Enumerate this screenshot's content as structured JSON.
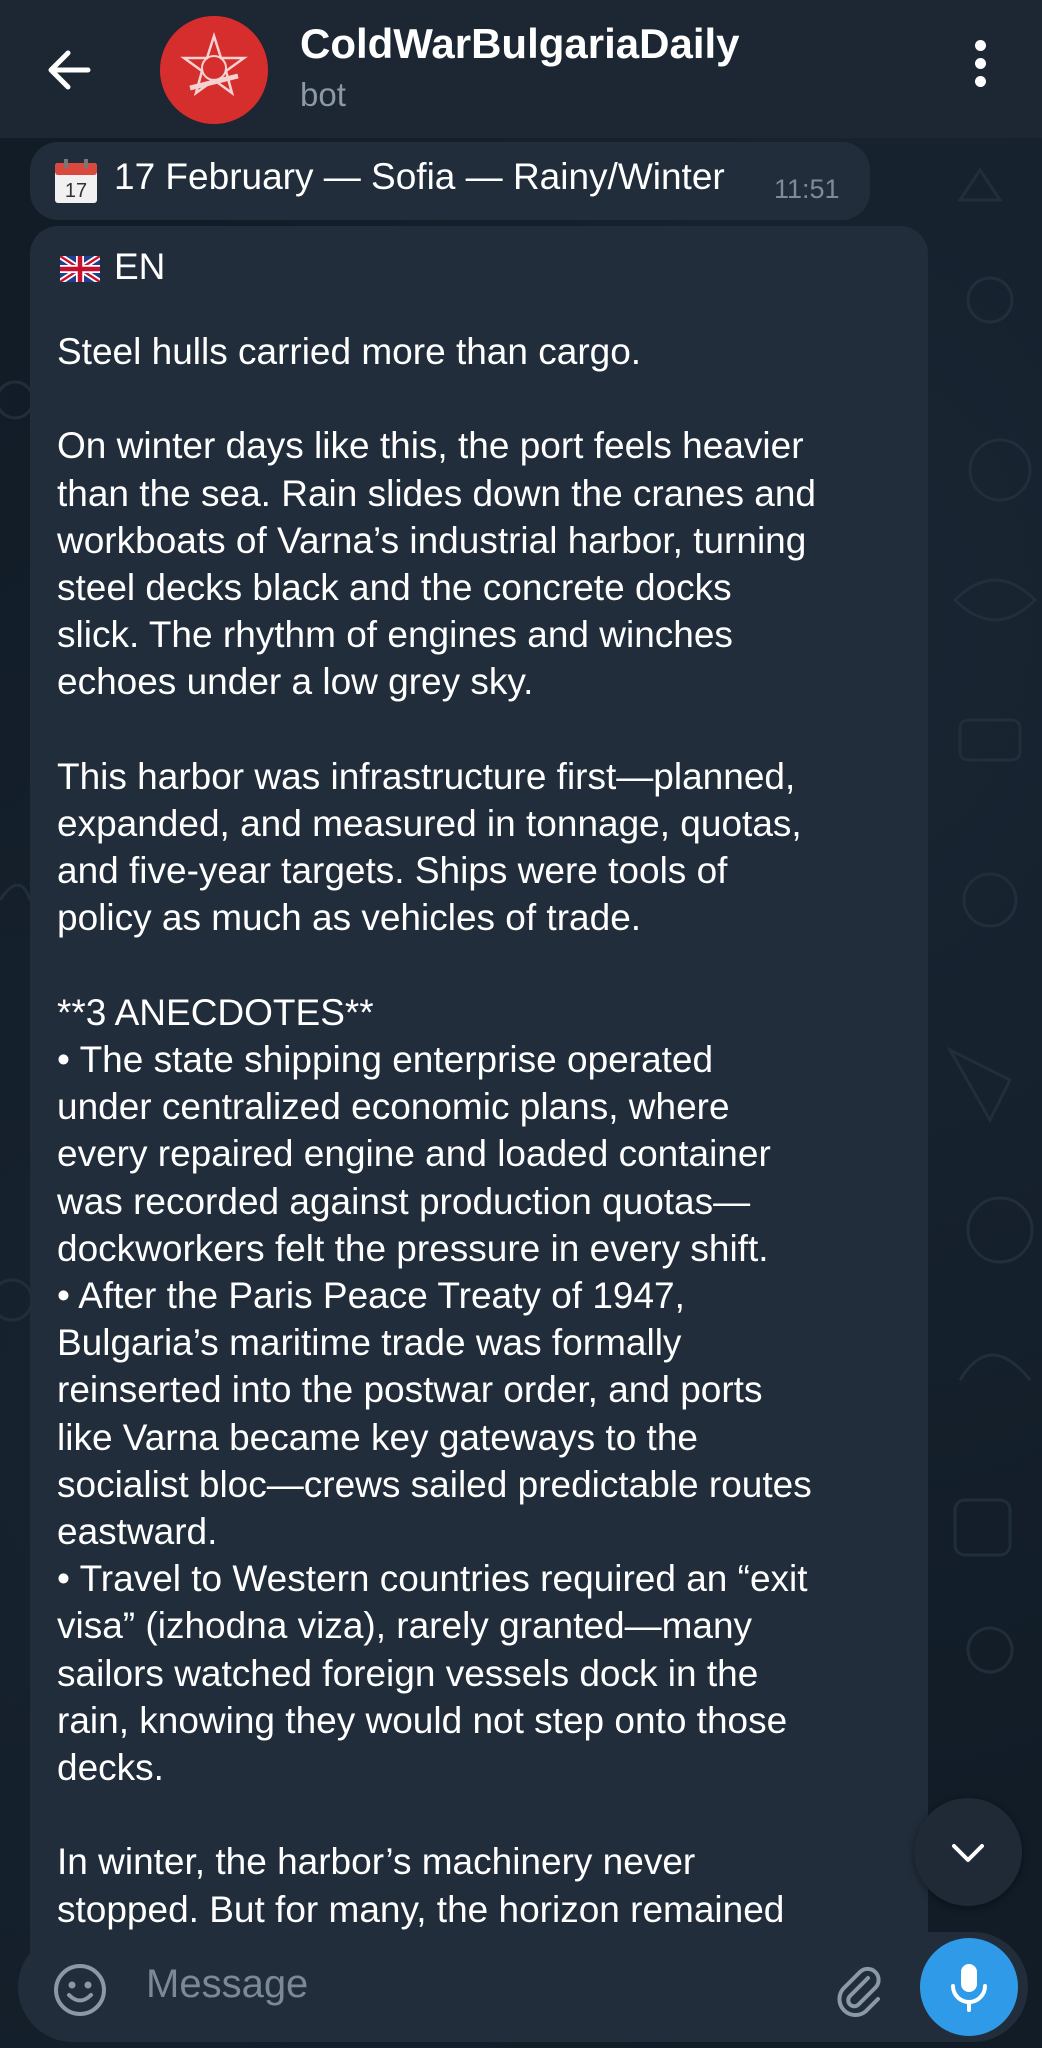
{
  "header": {
    "title": "ColdWarBulgariaDaily",
    "subtitle": "bot",
    "back_icon": "arrow-left-icon",
    "menu_icon": "more-vertical-icon",
    "avatar_color": "#d62d2d"
  },
  "messages": {
    "date_message": {
      "calendar_day": "17",
      "text": "17 February — Sofia — Rainy/Winter",
      "time": "11:51"
    },
    "post": {
      "lang": "EN",
      "flag_icon": "uk-flag-icon",
      "lines": [
        "Steel hulls carried more than cargo.",
        "",
        "On winter days like this, the port feels heavier",
        "than the sea. Rain slides down the cranes and",
        "workboats of Varna’s industrial harbor, turning",
        "steel decks black and the concrete docks",
        "slick. The rhythm of engines and winches",
        "echoes under a low grey sky.",
        "",
        "This harbor was infrastructure first—planned,",
        "expanded, and measured in tonnage, quotas,",
        "and five-year targets. Ships were tools of",
        "policy as much as vehicles of trade.",
        "",
        "**3 ANECDOTES**",
        "• The state shipping enterprise operated",
        "under centralized economic plans, where",
        "every repaired engine and loaded container",
        "was recorded against production quotas—",
        "dockworkers felt the pressure in every shift.",
        "• After the Paris Peace Treaty of 1947,",
        "Bulgaria’s maritime trade was formally",
        "reinserted into the postwar order, and ports",
        "like Varna became key gateways to the",
        "socialist bloc—crews sailed predictable routes",
        "eastward.",
        "• Travel to Western countries required an “exit",
        "visa” (izhodna viza), rarely granted—many",
        "sailors watched foreign vessels dock in the",
        "rain, knowing they would not step onto those",
        "decks.",
        "",
        "In winter, the harbor’s machinery never",
        "stopped. But for many, the horizon remained"
      ]
    }
  },
  "composer": {
    "placeholder": "Message",
    "emoji_icon": "emoji-icon",
    "attach_icon": "paperclip-icon",
    "mic_icon": "microphone-icon",
    "accent_color": "#2f9be8"
  },
  "scroll_button_icon": "chevron-down-icon"
}
